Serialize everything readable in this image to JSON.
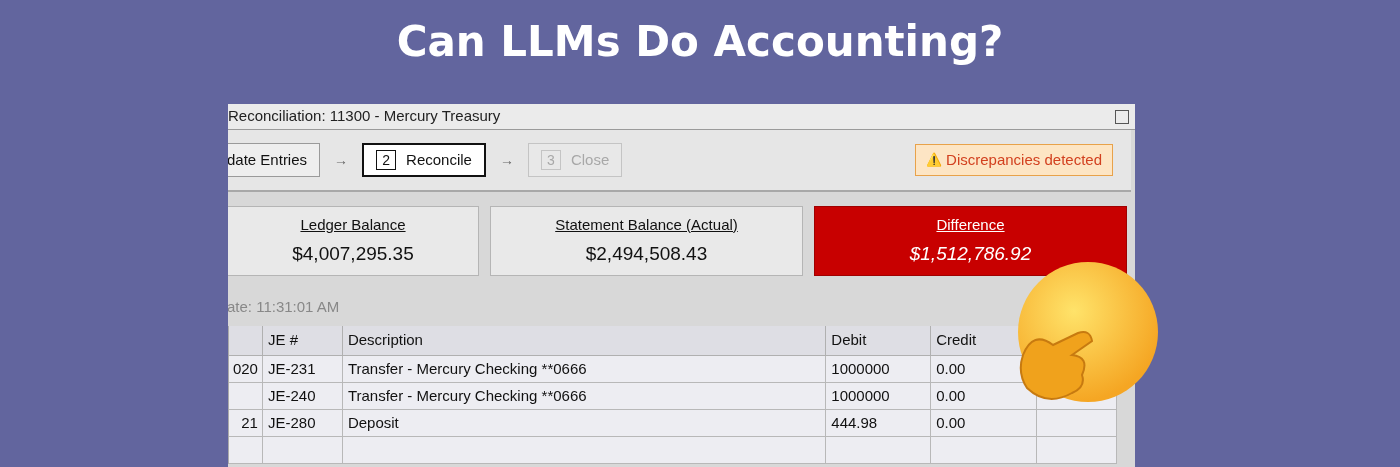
{
  "headline": "Can LLMs Do Accounting?",
  "window": {
    "title": "Reconciliation: 11300 - Mercury Treasury"
  },
  "steps": [
    {
      "label": "date Entries",
      "selected": false,
      "disabled": false
    },
    {
      "number": "2",
      "label": "Reconcile",
      "selected": true,
      "disabled": false
    },
    {
      "number": "3",
      "label": "Close",
      "selected": false,
      "disabled": true
    }
  ],
  "step_arrows": [
    "→",
    "→"
  ],
  "alert": {
    "icon": "⚠️",
    "text": "Discrepancies detected"
  },
  "balances": [
    {
      "label": "Ledger Balance",
      "value": "$4,007,295.35",
      "kind": "normal"
    },
    {
      "label": "Statement Balance (Actual)",
      "value": "$2,494,508.43",
      "kind": "normal"
    },
    {
      "label": "Difference",
      "value": "$1,512,786.92",
      "kind": "alert"
    }
  ],
  "last_update": "ate: 11:31:01 AM",
  "table": {
    "columns": [
      null,
      "JE #",
      "Description",
      "Debit",
      "Credit",
      null
    ],
    "rows": [
      [
        "020",
        "JE-231",
        "Transfer - Mercury Checking **0666",
        "1000000",
        "0.00",
        null
      ],
      [
        null,
        "JE-240",
        "Transfer - Mercury Checking **0666",
        "1000000",
        "0.00",
        null
      ],
      [
        "21",
        "JE-280",
        "Deposit",
        "444.98",
        "0.00",
        null
      ],
      [
        null,
        null,
        null,
        null,
        null,
        null
      ]
    ]
  }
}
